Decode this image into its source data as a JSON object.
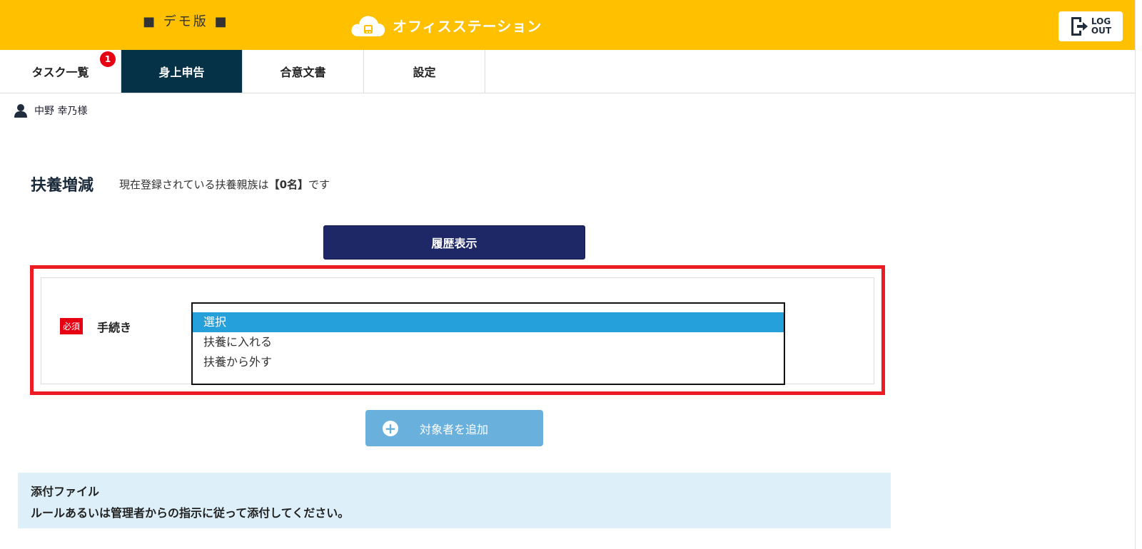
{
  "header": {
    "demo_label": "■ デモ版 ■",
    "brand_name": "オフィスステーション",
    "logout_line1": "LOG",
    "logout_line2": "OUT"
  },
  "nav": {
    "tabs": [
      {
        "label": "タスク一覧",
        "badge": "1"
      },
      {
        "label": "身上申告",
        "active": true
      },
      {
        "label": "合意文書"
      },
      {
        "label": "設定"
      }
    ]
  },
  "user": {
    "name": "中野 幸乃様"
  },
  "section": {
    "title": "扶養増減",
    "desc_prefix": "現在登録されている扶養親族は",
    "desc_count": "【0名】",
    "desc_suffix": "です"
  },
  "history_button": "履歴表示",
  "form": {
    "required_label": "必須",
    "field_label": "手続き",
    "options": [
      "選択",
      "扶養に入れる",
      "扶養から外す"
    ],
    "selected": "選択"
  },
  "add_button": "対象者を追加",
  "attachment": {
    "title": "添付ファイル",
    "description": "ルールあるいは管理者からの指示に従って添付してください。"
  },
  "colors": {
    "header_bg": "#ffc000",
    "active_tab": "#053247",
    "primary_button": "#1f2866",
    "highlight": "#ed1c24",
    "selected_option": "#26a0da",
    "add_button": "#6ab0dc",
    "attachment_bg": "#ddf0f9"
  }
}
